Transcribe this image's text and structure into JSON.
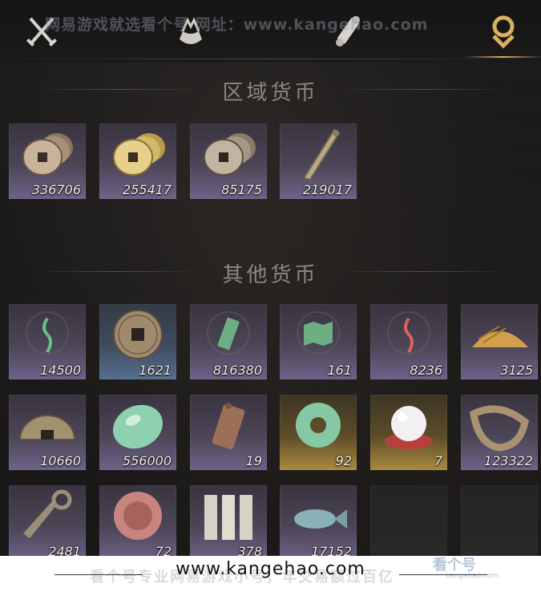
{
  "colors": {
    "background": "#1b1a1a",
    "tile_purple": "#6e6288",
    "tile_gold": "#a88a3e",
    "tile_blue": "#56708f",
    "active_tab": "#d8b060",
    "heading": "#8e877e"
  },
  "watermark_top": "网易游戏就选看个号   网址：www.kangehao.com",
  "tabs": [
    {
      "icon": "crossed-swords-icon",
      "active": false
    },
    {
      "icon": "bundle-icon",
      "active": false
    },
    {
      "icon": "scroll-icon",
      "active": false
    },
    {
      "icon": "currency-icon",
      "active": true
    }
  ],
  "regional": {
    "title": "区域货币",
    "items": [
      {
        "icon": "coin-stack-icon",
        "count": "336706"
      },
      {
        "icon": "gold-coin-stack-icon",
        "count": "255417"
      },
      {
        "icon": "coin-stack-icon",
        "count": "85175"
      },
      {
        "icon": "blade-token-icon",
        "count": "219017"
      }
    ]
  },
  "other": {
    "title": "其他货币",
    "items": [
      {
        "icon": "green-glyph-icon",
        "count": "14500"
      },
      {
        "icon": "bronze-coin-icon",
        "count": "1621"
      },
      {
        "icon": "jade-tablet-icon",
        "count": "816380"
      },
      {
        "icon": "map-fragment-icon",
        "count": "161"
      },
      {
        "icon": "red-glyph-icon",
        "count": "8236"
      },
      {
        "icon": "grain-pile-icon",
        "count": "3125"
      },
      {
        "icon": "half-coin-icon",
        "count": "10660"
      },
      {
        "icon": "jade-stone-icon",
        "count": "556000"
      },
      {
        "icon": "copper-plaque-icon",
        "count": "19"
      },
      {
        "icon": "jade-ring-icon",
        "count": "92"
      },
      {
        "icon": "pearl-icon",
        "count": "7"
      },
      {
        "icon": "coin-string-icon",
        "count": "123322"
      },
      {
        "icon": "spade-coin-icon",
        "count": "2481"
      },
      {
        "icon": "pink-seal-icon",
        "count": "72"
      },
      {
        "icon": "paper-notes-icon",
        "count": "378"
      },
      {
        "icon": "fish-icon",
        "count": "17152"
      }
    ]
  },
  "footer": {
    "url": "www.kangehao.com",
    "ghost_text": "看个号专业网易游戏小号，年交易额过百亿",
    "mark": "看个号",
    "mark_sub": "kangehao.com"
  }
}
